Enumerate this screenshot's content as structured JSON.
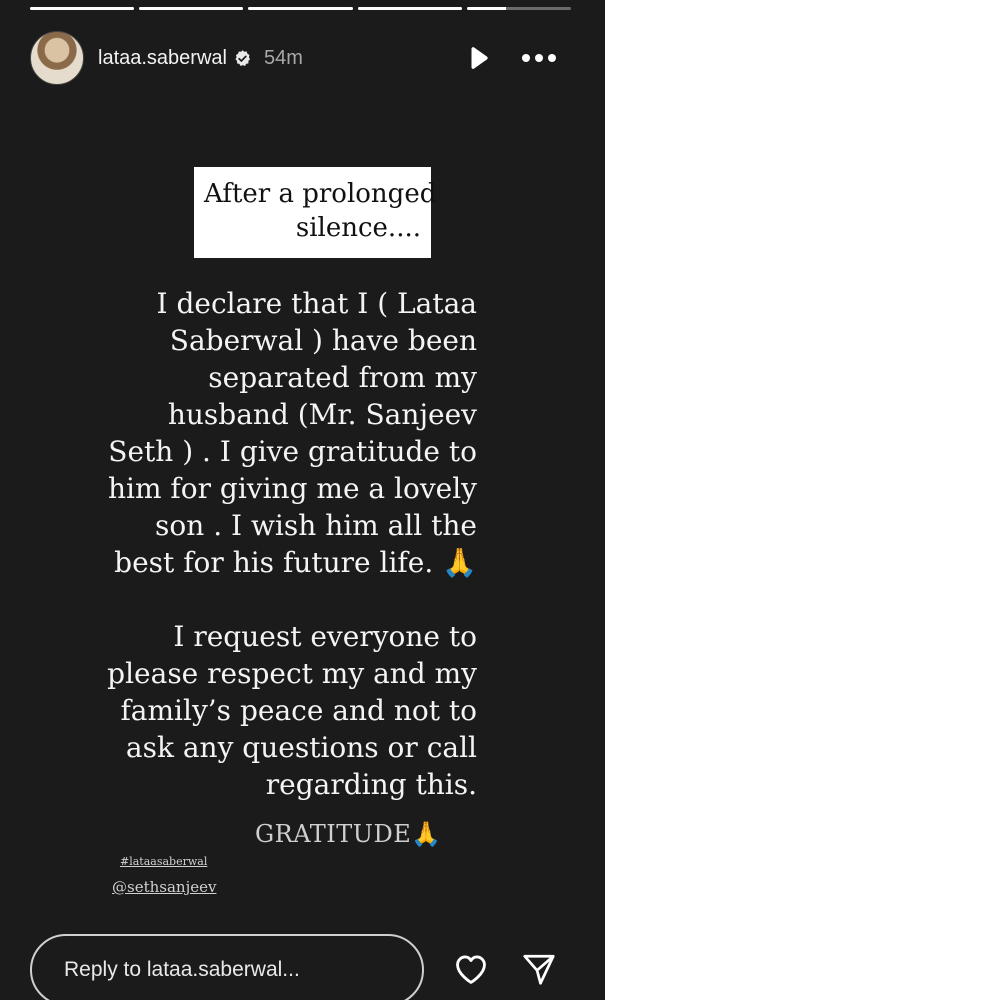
{
  "story": {
    "progress": [
      1,
      1,
      1,
      1,
      0.38
    ],
    "user": {
      "username": "lataa.saberwal",
      "verified": true,
      "time_ago": "54m"
    },
    "header_icons": [
      "verified-badge-icon",
      "play-icon",
      "more-icon"
    ],
    "title_lines": [
      "After a prolonged",
      "silence...."
    ],
    "body_lines": [
      "I declare that I ( Lataa",
      "Saberwal ) have been",
      "separated from my",
      "husband (Mr. Sanjeev",
      "Seth ) . I give gratitude to",
      "him for giving me a lovely",
      "son .  I wish him all the",
      "best for his future life. 🙏",
      "",
      "I request everyone to",
      "please  respect my and my",
      "family’s peace and not to",
      "ask any questions or call",
      "regarding this."
    ],
    "closing": "GRATITUDE🙏",
    "hashtag": "#lataasaberwal",
    "mention": "@sethsanjeev",
    "reply_placeholder": "Reply to lataa.saberwal...",
    "footer_icons": [
      "heart-icon",
      "send-icon"
    ],
    "colors": {
      "background": "#1b1b1b",
      "text": "#f4f4f4",
      "title_box": "#ffffff"
    }
  }
}
